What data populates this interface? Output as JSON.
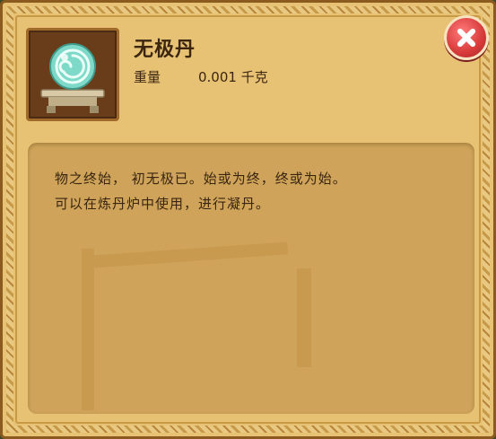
{
  "item": {
    "name": "无极丹",
    "weight_label": "重量",
    "weight_value": "0.001 千克",
    "icon": "jade-orb-on-stand"
  },
  "description": {
    "line1": "物之终始， 初无极已。始或为终，终或为始。",
    "line2": "可以在炼丹炉中使用，进行凝丹。"
  },
  "close_button": {
    "icon": "close-icon"
  },
  "colors": {
    "panel": "#e7c274",
    "desc_bg": "#cfa45a",
    "close": "#d73a3a",
    "text": "#3c2610"
  }
}
